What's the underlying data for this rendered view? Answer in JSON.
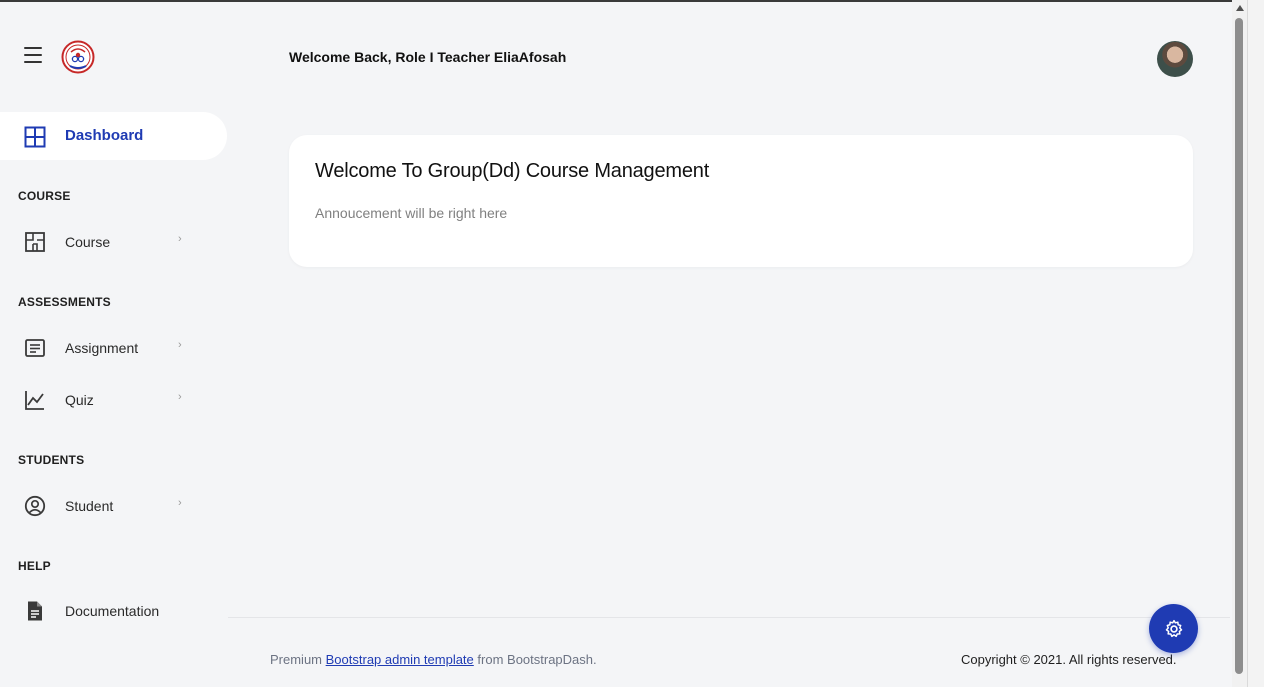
{
  "header": {
    "welcome": "Welcome Back, Role I Teacher EliaAfosah"
  },
  "sidebar": {
    "dashboard_label": "Dashboard",
    "sections": [
      {
        "title": "COURSE",
        "items": [
          {
            "label": "Course",
            "icon": "floor-plan-icon"
          }
        ]
      },
      {
        "title": "ASSESSMENTS",
        "items": [
          {
            "label": "Assignment",
            "icon": "message-text-icon"
          },
          {
            "label": "Quiz",
            "icon": "chart-line-icon"
          }
        ]
      },
      {
        "title": "STUDENTS",
        "items": [
          {
            "label": "Student",
            "icon": "account-circle-icon"
          }
        ]
      },
      {
        "title": "HELP",
        "items": [
          {
            "label": "Documentation",
            "icon": "file-document-icon"
          }
        ]
      }
    ],
    "chevron": "›"
  },
  "card": {
    "title": "Welcome To Group(Dd) Course Management",
    "subtitle": "Annoucement will be right here"
  },
  "footer": {
    "premium": "Premium",
    "link": "Bootstrap admin template",
    "from": "from BootstrapDash.",
    "copyright": "Copyright © 2021. All rights reserved."
  },
  "colors": {
    "accent": "#1f3bb3",
    "background": "#f4f5f7",
    "card": "#ffffff"
  }
}
